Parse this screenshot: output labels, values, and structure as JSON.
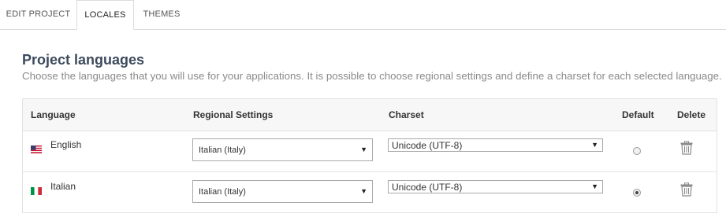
{
  "tabs": [
    {
      "label": "EDIT PROJECT",
      "active": false
    },
    {
      "label": "LOCALES",
      "active": true
    },
    {
      "label": "THEMES",
      "active": false
    }
  ],
  "section": {
    "title": "Project languages",
    "description": "Choose the languages that you will use for your applications. It is possible to choose regional settings and define a charset for each selected language."
  },
  "table": {
    "headers": {
      "language": "Language",
      "regional": "Regional Settings",
      "charset": "Charset",
      "default": "Default",
      "delete": "Delete"
    },
    "rows": [
      {
        "flag": "us-flag-icon",
        "language": "English",
        "regional": "Italian (Italy)",
        "charset": "Unicode (UTF-8)",
        "default": false
      },
      {
        "flag": "italy-flag-icon",
        "language": "Italian",
        "regional": "Italian (Italy)",
        "charset": "Unicode (UTF-8)",
        "default": true
      }
    ]
  },
  "icons": {
    "dropdown_arrow": "▼",
    "delete": "trash-icon"
  },
  "colors": {
    "title": "#3c4a5c",
    "subtitle": "#8a8a8a",
    "header_bg": "#f7f7f7",
    "border": "#e2e2e2"
  }
}
